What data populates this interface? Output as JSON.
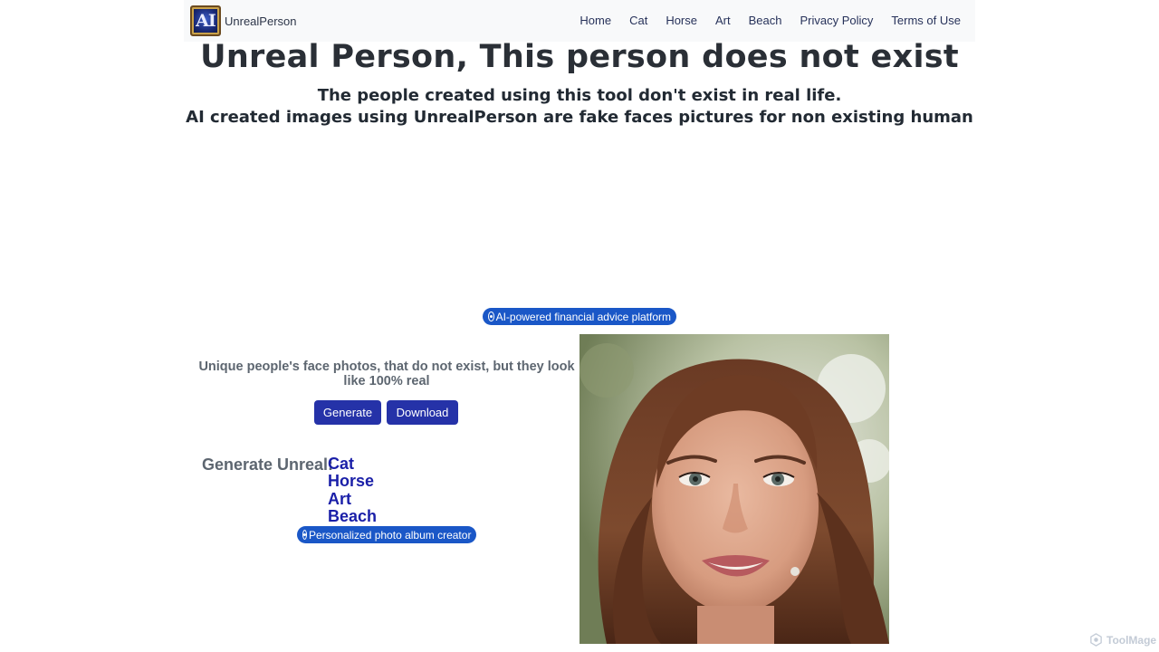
{
  "nav": {
    "brand_logo_text": "AI",
    "brand_name": "UnrealPerson",
    "links": [
      "Home",
      "Cat",
      "Horse",
      "Art",
      "Beach",
      "Privacy Policy",
      "Terms of Use"
    ]
  },
  "hero": {
    "title": "Unreal Person, This person does not exist",
    "subtitle_line1": "The people created using this tool don't exist in real life.",
    "subtitle_line2": "AI created images using UnrealPerson are fake faces pictures for non existing human"
  },
  "ads": {
    "top": "AI-powered financial advice platform",
    "bottom": "Personalized photo album creator"
  },
  "generator": {
    "tagline": "Unique people's face photos, that do not exist, but they look like 100% real",
    "generate_label": "Generate",
    "download_label": "Download",
    "unreal_label": "Generate Unreal:",
    "categories": [
      "Cat",
      "Horse",
      "Art",
      "Beach"
    ]
  },
  "watermark": {
    "text": "ToolMage"
  },
  "colors": {
    "button_bg": "#2532a8",
    "ad_pill_bg": "#1a57c7",
    "category_link": "#1a1fa8",
    "navbar_bg": "#f8f9fa"
  }
}
